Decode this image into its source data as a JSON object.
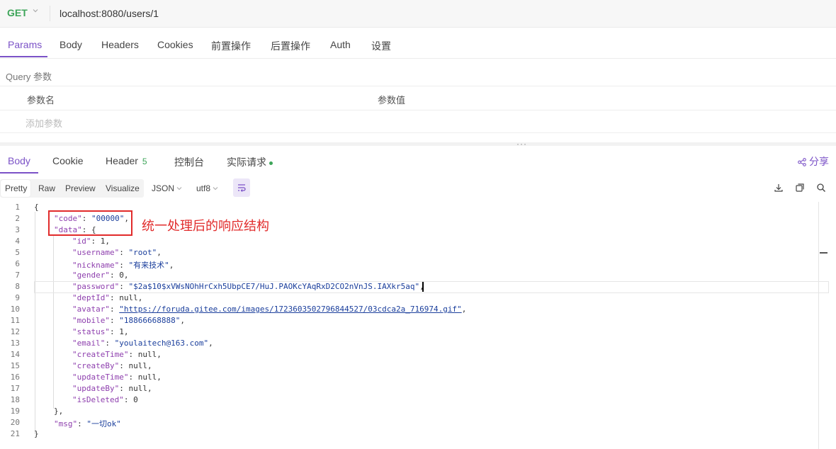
{
  "request": {
    "method": "GET",
    "url": "localhost:8080/users/1",
    "tabs": [
      "Params",
      "Body",
      "Headers",
      "Cookies",
      "前置操作",
      "后置操作",
      "Auth",
      "设置"
    ],
    "section_label": "Query 参数",
    "columns": [
      "参数名",
      "参数值"
    ],
    "add_param_placeholder": "添加参数"
  },
  "response": {
    "tabs": [
      "Body",
      "Cookie",
      "Header",
      "控制台",
      "实际请求"
    ],
    "header_count": "5",
    "share_label": "分享",
    "formats": [
      "Pretty",
      "Raw",
      "Preview",
      "Visualize"
    ],
    "type_select": "JSON",
    "encoding_select": "utf8"
  },
  "annotation": "统一处理后的响应结构",
  "code": {
    "line_numbers": [
      "1",
      "2",
      "3",
      "4",
      "5",
      "6",
      "7",
      "8",
      "9",
      "10",
      "11",
      "12",
      "13",
      "14",
      "15",
      "16",
      "17",
      "18",
      "19",
      "20",
      "21"
    ],
    "brace_open": "{",
    "code_key": "\"code\"",
    "code_val": "\"00000\"",
    "data_key": "\"data\"",
    "id_key": "\"id\"",
    "id_val": "1",
    "username_key": "\"username\"",
    "username_val": "\"root\"",
    "nickname_key": "\"nickname\"",
    "nickname_val": "\"有来技术\"",
    "gender_key": "\"gender\"",
    "gender_val": "0",
    "password_key": "\"password\"",
    "password_val": "\"$2a$10$xVWsNOhHrCxh5UbpCE7/HuJ.PAOKcYAqRxD2CO2nVnJS.IAXkr5aq\"",
    "deptId_key": "\"deptId\"",
    "deptId_val": "null",
    "avatar_key": "\"avatar\"",
    "avatar_val": "\"https://foruda.gitee.com/images/1723603502796844527/03cdca2a_716974.gif\"",
    "mobile_key": "\"mobile\"",
    "mobile_val": "\"18866668888\"",
    "status_key": "\"status\"",
    "status_val": "1",
    "email_key": "\"email\"",
    "email_val": "\"youlaitech@163.com\"",
    "createTime_key": "\"createTime\"",
    "createTime_val": "null",
    "createBy_key": "\"createBy\"",
    "createBy_val": "null",
    "updateTime_key": "\"updateTime\"",
    "updateTime_val": "null",
    "updateBy_key": "\"updateBy\"",
    "updateBy_val": "null",
    "isDeleted_key": "\"isDeleted\"",
    "isDeleted_val": "0",
    "data_close": "},",
    "msg_key": "\"msg\"",
    "msg_val": "\"一切ok\"",
    "brace_close": "}"
  },
  "colors": {
    "accent": "#7b52c7",
    "get": "#3ea55a",
    "annotation": "#e12b2b"
  },
  "icons": [
    "chevron-down-icon",
    "share-icon",
    "download-icon",
    "copy-icon",
    "search-icon",
    "wrap-icon"
  ]
}
